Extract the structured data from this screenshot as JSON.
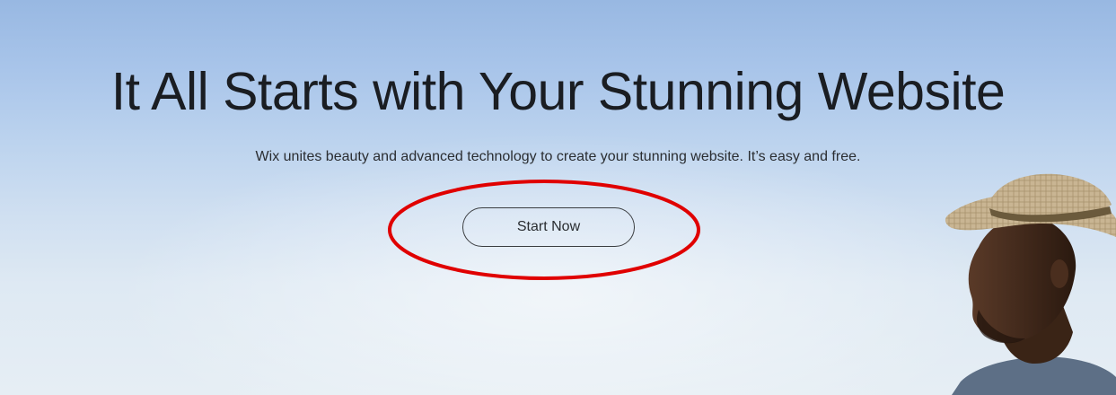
{
  "hero": {
    "headline": "It All Starts with Your Stunning Website",
    "subheadline": "Wix unites beauty and advanced technology to create your stunning website. It’s easy and free.",
    "cta_label": "Start Now",
    "annotation_color": "#e00000"
  }
}
